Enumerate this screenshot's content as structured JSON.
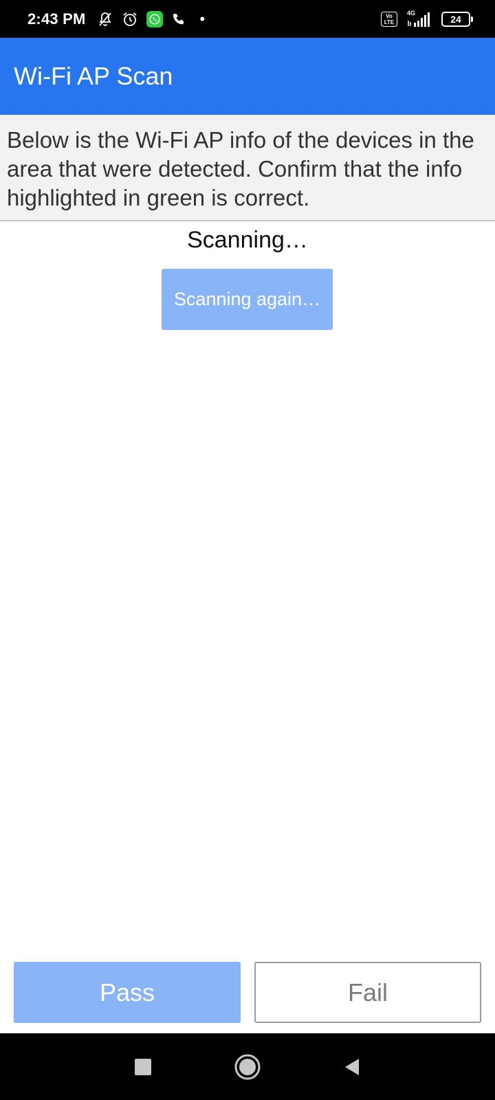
{
  "status_bar": {
    "time": "2:43 PM",
    "volte_top": "Vo",
    "volte_bottom": "LTE",
    "network_label": "4G",
    "battery_level": "24",
    "icons": [
      "bell-off-icon",
      "alarm-icon",
      "whatsapp-icon",
      "phone-call-icon",
      "notification-dot-icon",
      "volte-icon",
      "signal-icon",
      "battery-icon"
    ]
  },
  "app_bar": {
    "title": "Wi-Fi AP Scan",
    "color": "#2776f0"
  },
  "instructions": {
    "text": "Below is the Wi-Fi AP info of the devices in the area that were detected. Confirm that the info highlighted in green is correct."
  },
  "scan": {
    "status": "Scanning…",
    "button_label": "Scanning again…"
  },
  "actions": {
    "pass_label": "Pass",
    "fail_label": "Fail",
    "disabled_color": "#8ab4f8"
  },
  "nav_bar": {
    "icons": [
      "recents-square-icon",
      "home-circle-icon",
      "back-triangle-icon"
    ]
  }
}
